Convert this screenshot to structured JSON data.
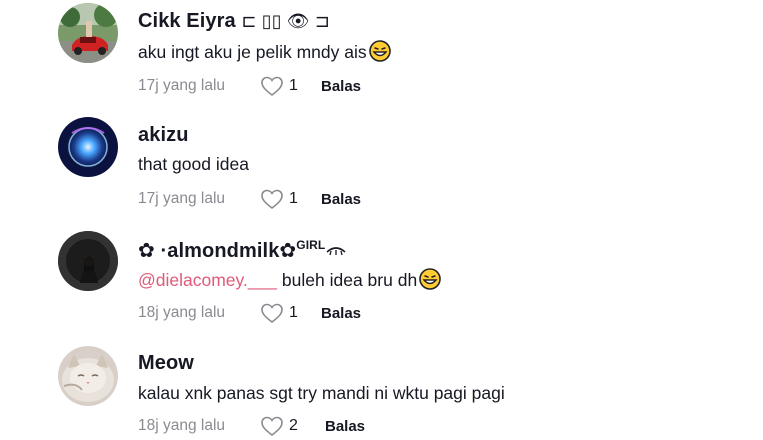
{
  "comments": [
    {
      "username": "Cikk Eiyra",
      "username_deco": "⊏ ▯▯ 👁 ⊐",
      "text": "aku ingt aku je pelik mndy ais",
      "time": "17j yang lalu",
      "likes": "1",
      "reply": "Balas"
    },
    {
      "username": "akizu",
      "text": "that good idea",
      "time": "17j yang lalu",
      "likes": "1",
      "reply": "Balas"
    },
    {
      "username_prefix": "✿ ·",
      "username": "almondmilk",
      "username_suffix": "✿",
      "username_sup": "GIRL",
      "mention": "@dielacomey.___",
      "text": "buleh idea bru dh",
      "time": "18j yang lalu",
      "likes": "1",
      "reply": "Balas"
    },
    {
      "username": "Meow",
      "text": "kalau xnk panas sgt try mandi ni wktu pagi pagi",
      "time": "18j yang lalu",
      "likes": "2",
      "reply": "Balas"
    }
  ]
}
